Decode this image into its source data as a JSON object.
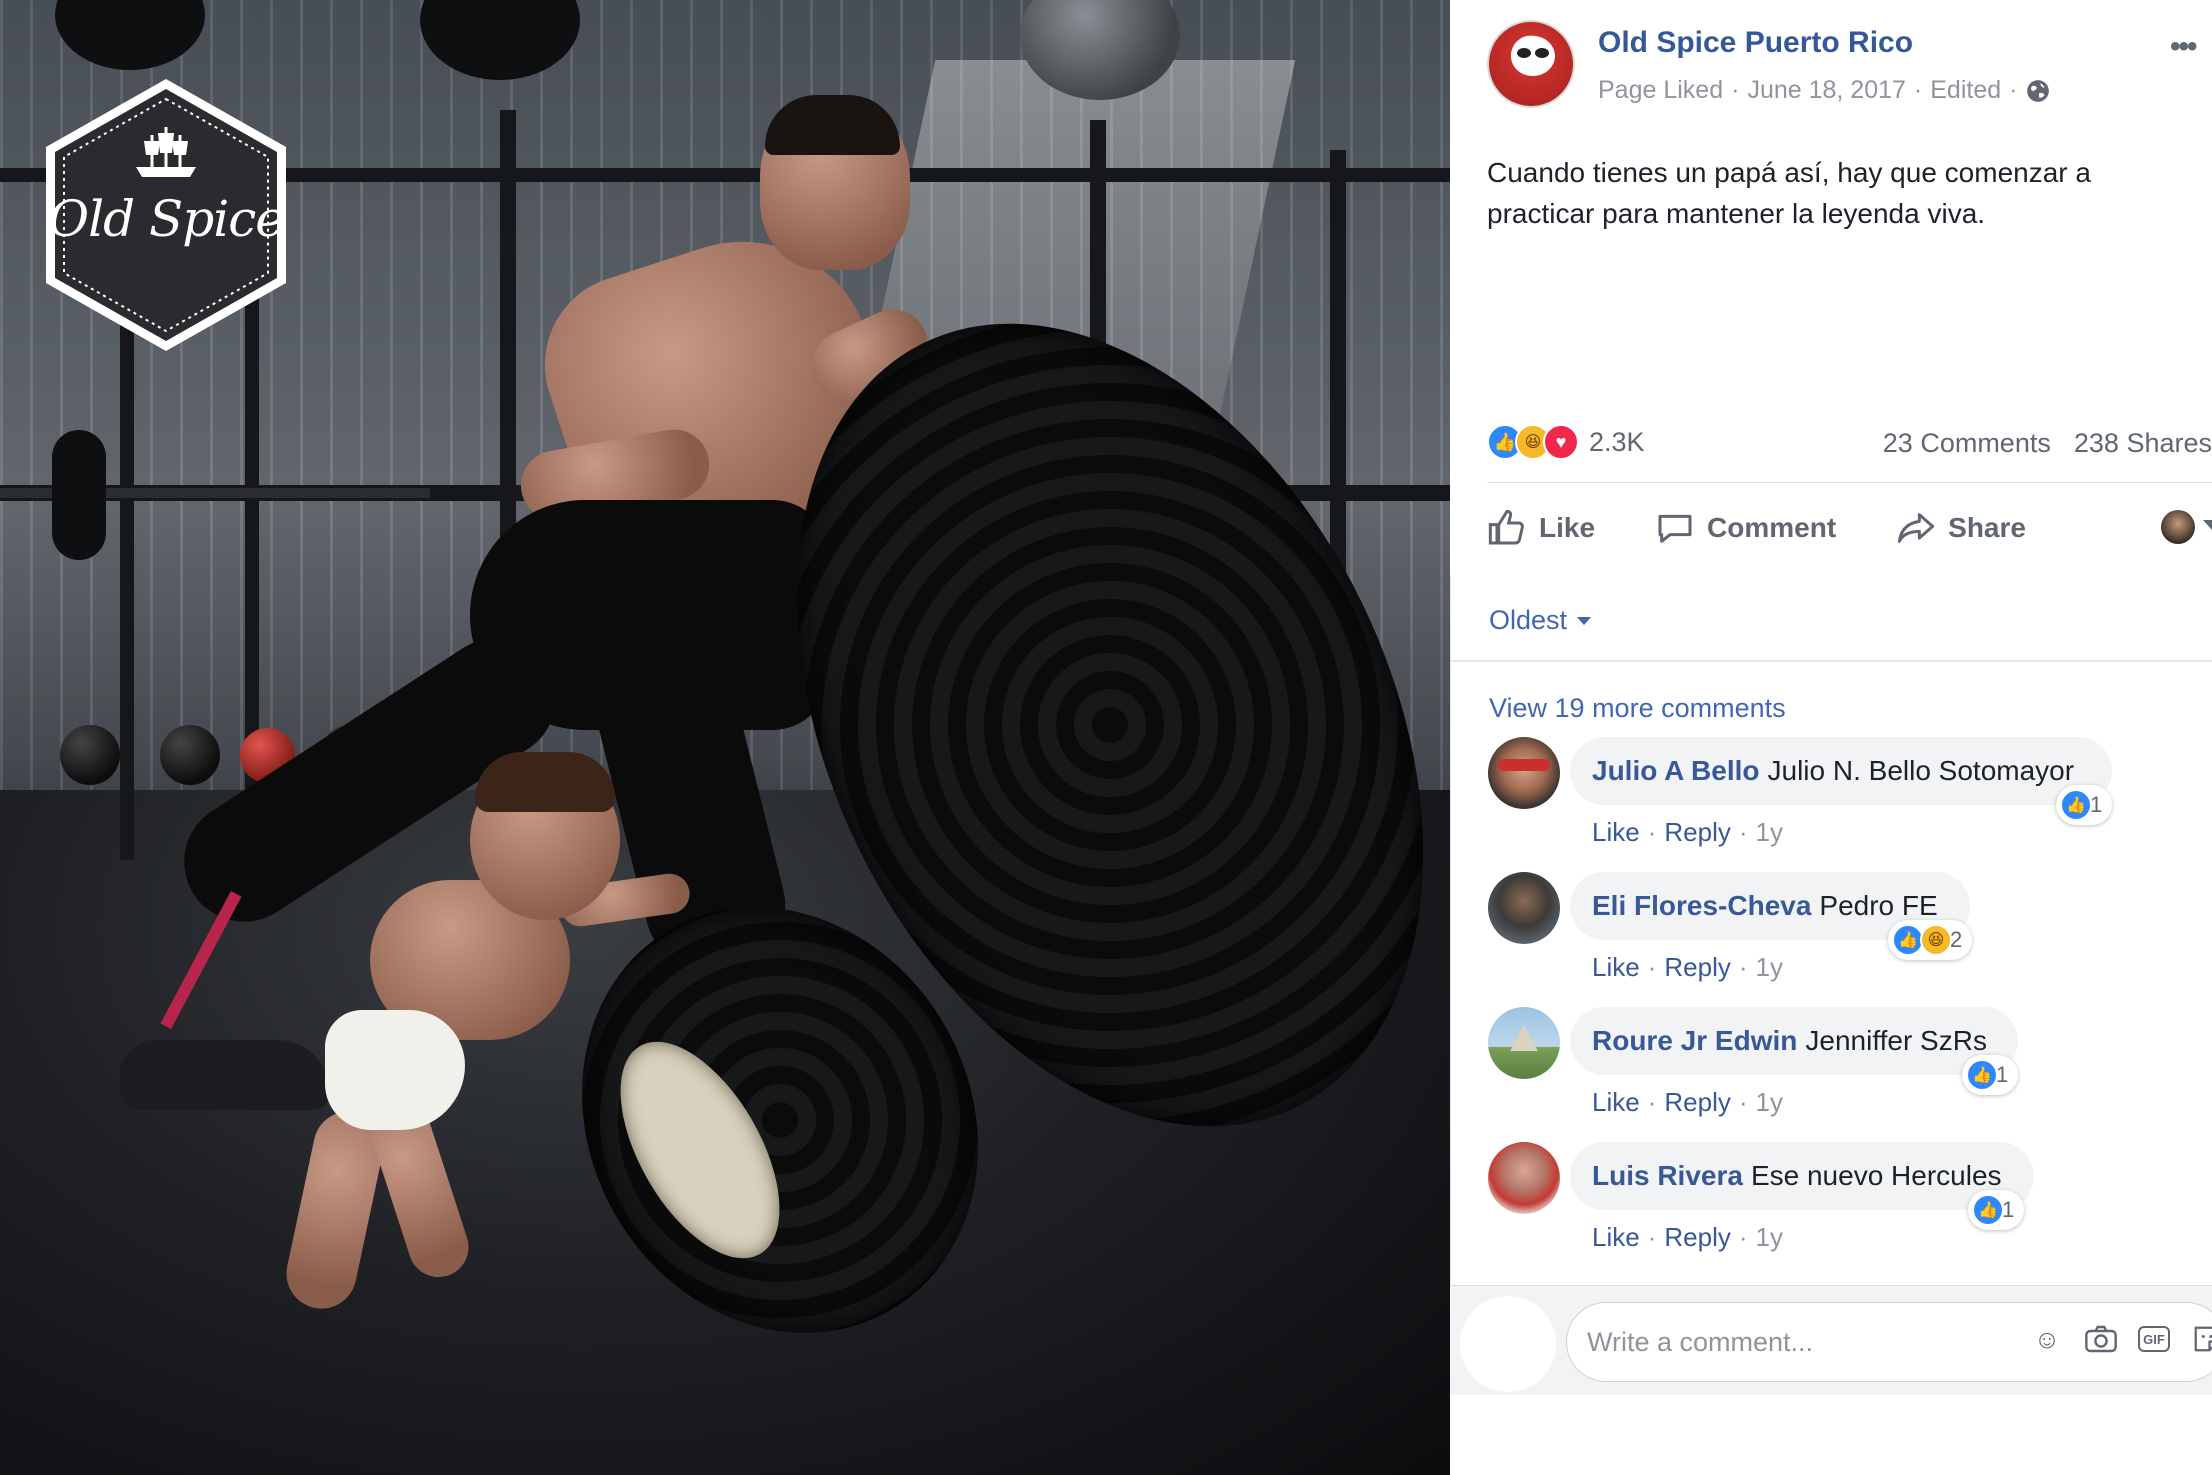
{
  "photo": {
    "brand_logo_text": "Old Spice"
  },
  "post": {
    "page_name": "Old Spice Puerto Rico",
    "meta": {
      "liked": "Page Liked",
      "sep1": "·",
      "date": "June 18, 2017",
      "sep2": "·",
      "edited": "Edited",
      "sep3": "·",
      "privacy_icon": "globe-icon"
    },
    "more_icon": "•••",
    "text": "Cuando tienes un papá así, hay que comenzar a practicar para mantener la leyenda viva.",
    "reactions": {
      "types": [
        "like",
        "haha",
        "love"
      ],
      "count": "2.3K"
    },
    "comments_count": "23 Comments",
    "shares_count": "238 Shares",
    "actions": {
      "like": "Like",
      "comment": "Comment",
      "share": "Share"
    },
    "colors": {
      "link": "#365899",
      "action_grey": "#606770",
      "like_blue": "#2d88ff",
      "love_red": "#f0284a",
      "haha_yellow": "#f7b928"
    }
  },
  "comments_section": {
    "sort_label": "Oldest",
    "view_more": "View 19 more comments",
    "comments": [
      {
        "author": "Julio A Bello",
        "text": "Julio N. Bello Sotomayor",
        "actions": {
          "like": "Like",
          "reply": "Reply",
          "time": "1y"
        },
        "reaction_types": [
          "like"
        ],
        "reaction_count": "1"
      },
      {
        "author": "Eli Flores-Cheva",
        "text": "Pedro FE",
        "actions": {
          "like": "Like",
          "reply": "Reply",
          "time": "1y"
        },
        "reaction_types": [
          "like",
          "haha"
        ],
        "reaction_count": "2"
      },
      {
        "author": "Roure Jr Edwin",
        "text": "Jenniffer SzRs",
        "actions": {
          "like": "Like",
          "reply": "Reply",
          "time": "1y"
        },
        "reaction_types": [
          "like"
        ],
        "reaction_count": "1"
      },
      {
        "author": "Luis Rivera",
        "text": "Ese nuevo Hercules",
        "actions": {
          "like": "Like",
          "reply": "Reply",
          "time": "1y"
        },
        "reaction_types": [
          "like"
        ],
        "reaction_count": "1"
      }
    ],
    "separator": "·",
    "write_placeholder": "Write a comment...",
    "composer_icons": [
      "emoji-icon",
      "camera-icon",
      "gif-icon",
      "sticker-icon"
    ],
    "gif_label": "GIF"
  }
}
